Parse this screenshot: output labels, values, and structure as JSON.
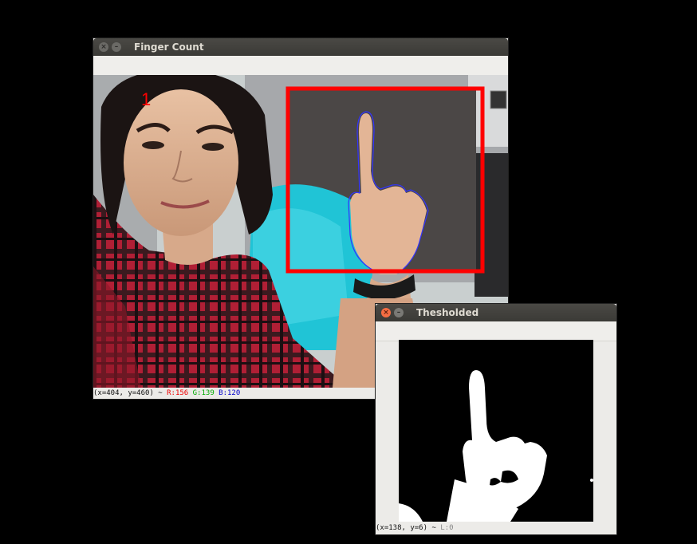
{
  "main_window": {
    "title": "Finger Count",
    "finger_count": "1",
    "status": {
      "coords": "(x=404, y=460) ~ ",
      "r": "R:156",
      "g": "G:139",
      "b": "B:120"
    }
  },
  "threshold_window": {
    "title": "Thesholded",
    "status": {
      "coords": "(x=138, y=6) ~ ",
      "l": "L:0"
    }
  },
  "icons": {
    "close": "close-icon",
    "minimize": "minimize-icon"
  },
  "colors": {
    "roi_box": "#ff0000",
    "contour": "#3333ff",
    "count_text": "#ff0000"
  }
}
